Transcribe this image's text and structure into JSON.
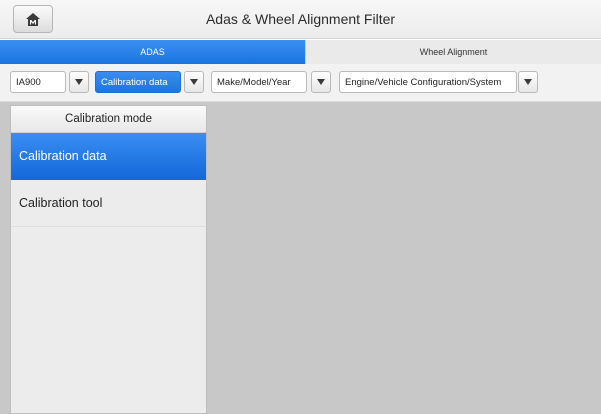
{
  "header": {
    "title": "Adas & Wheel Alignment Filter",
    "home_icon": "home-m-icon"
  },
  "tabs": [
    {
      "label": "ADAS",
      "active": true
    },
    {
      "label": "Wheel Alignment",
      "active": false
    }
  ],
  "filters": [
    {
      "value": "IA900",
      "active": false
    },
    {
      "value": "Calibration data",
      "active": true
    },
    {
      "value": "Make/Model/Year",
      "active": false
    },
    {
      "value": "Engine/Vehicle Configuration/System",
      "active": false
    }
  ],
  "sidebar": {
    "heading": "Calibration mode",
    "items": [
      {
        "label": "Calibration data",
        "selected": true
      },
      {
        "label": "Calibration tool",
        "selected": false
      }
    ]
  },
  "colors": {
    "accent": "#1a74e0",
    "content_bg": "#c8c8c8"
  }
}
